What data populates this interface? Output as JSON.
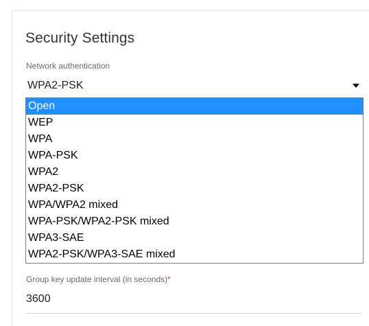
{
  "section": {
    "title": "Security Settings"
  },
  "network_authentication": {
    "label": "Network authentication",
    "selected_value": "WPA2-PSK",
    "options": [
      "Open",
      "WEP",
      "WPA",
      "WPA-PSK",
      "WPA2",
      "WPA2-PSK",
      "WPA/WPA2 mixed",
      "WPA-PSK/WPA2-PSK mixed",
      "WPA3-SAE",
      "WPA2-PSK/WPA3-SAE mixed"
    ],
    "highlighted_option": "Open"
  },
  "group_key_update_interval": {
    "label": "Group key update interval (in seconds)",
    "required_marker": "*",
    "value": "3600"
  },
  "colors": {
    "highlight": "#1e90ff",
    "required": "#d83b3b",
    "label": "#6b6b6b"
  },
  "icons": {
    "dropdown_caret": "caret-down-icon"
  }
}
